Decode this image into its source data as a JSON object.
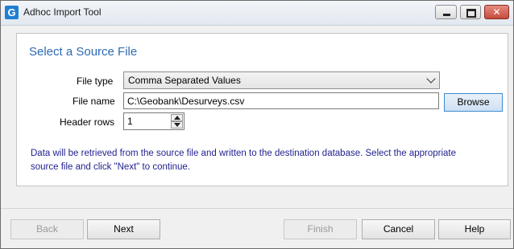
{
  "window": {
    "title": "Adhoc Import Tool",
    "icon_letter": "G",
    "controls": {
      "minimize": "minimize-icon",
      "maximize": "maximize-icon",
      "close": "close-icon"
    }
  },
  "page": {
    "heading": "Select a Source File",
    "file_type": {
      "label": "File type",
      "value": "Comma Separated Values"
    },
    "file_name": {
      "label": "File name",
      "value": "C:\\Geobank\\Desurveys.csv"
    },
    "browse_label": "Browse",
    "header_rows": {
      "label": "Header rows",
      "value": "1"
    },
    "info_text": "Data will be retrieved from the source file and written to the destination database. Select the appropriate source file and click \"Next\" to continue."
  },
  "footer": {
    "back": "Back",
    "next": "Next",
    "finish": "Finish",
    "cancel": "Cancel",
    "help": "Help"
  },
  "colors": {
    "heading": "#2e6bb1",
    "info_text": "#1f1f8f",
    "accent_button_border": "#3d8ad1",
    "close_button": "#c44c3c"
  }
}
